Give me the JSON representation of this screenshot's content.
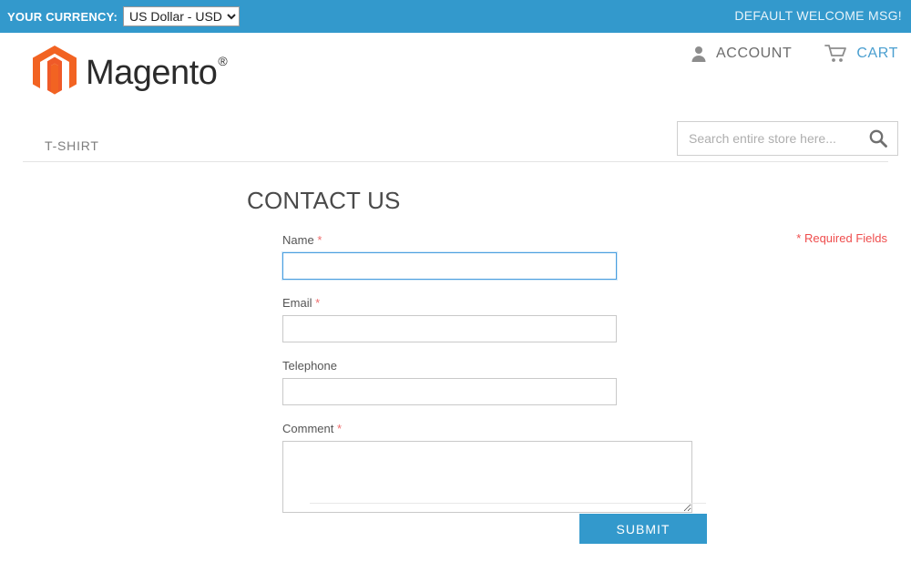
{
  "topbar": {
    "currency_label": "YOUR CURRENCY:",
    "currency_selected": "US Dollar - USD",
    "currency_options": [
      "US Dollar - USD"
    ],
    "welcome_message": "DEFAULT WELCOME MSG!",
    "background_color": "#3399cc"
  },
  "header": {
    "logo_text": "Magento",
    "logo_registered": "®",
    "account_label": "ACCOUNT",
    "cart_label": "CART",
    "account_icon": "user-icon",
    "cart_icon": "shopping-cart-icon",
    "search": {
      "placeholder": "Search entire store here...",
      "value": "",
      "icon": "search-icon"
    }
  },
  "nav": {
    "items": [
      {
        "label": "T-SHIRT"
      }
    ]
  },
  "main": {
    "page_title": "CONTACT US",
    "required_note": "* Required Fields",
    "required_note_color": "#ef4d4d",
    "form": {
      "fields": [
        {
          "name": "name",
          "label": "Name",
          "required": true,
          "required_marker": "*",
          "type": "text",
          "value": "",
          "focused": true
        },
        {
          "name": "email",
          "label": "Email",
          "required": true,
          "required_marker": "*",
          "type": "text",
          "value": "",
          "focused": false
        },
        {
          "name": "telephone",
          "label": "Telephone",
          "required": false,
          "required_marker": "",
          "type": "text",
          "value": "",
          "focused": false
        },
        {
          "name": "comment",
          "label": "Comment",
          "required": true,
          "required_marker": "*",
          "type": "textarea",
          "value": "",
          "focused": false
        }
      ],
      "submit_label": "SUBMIT",
      "submit_color": "#3399cc"
    }
  }
}
